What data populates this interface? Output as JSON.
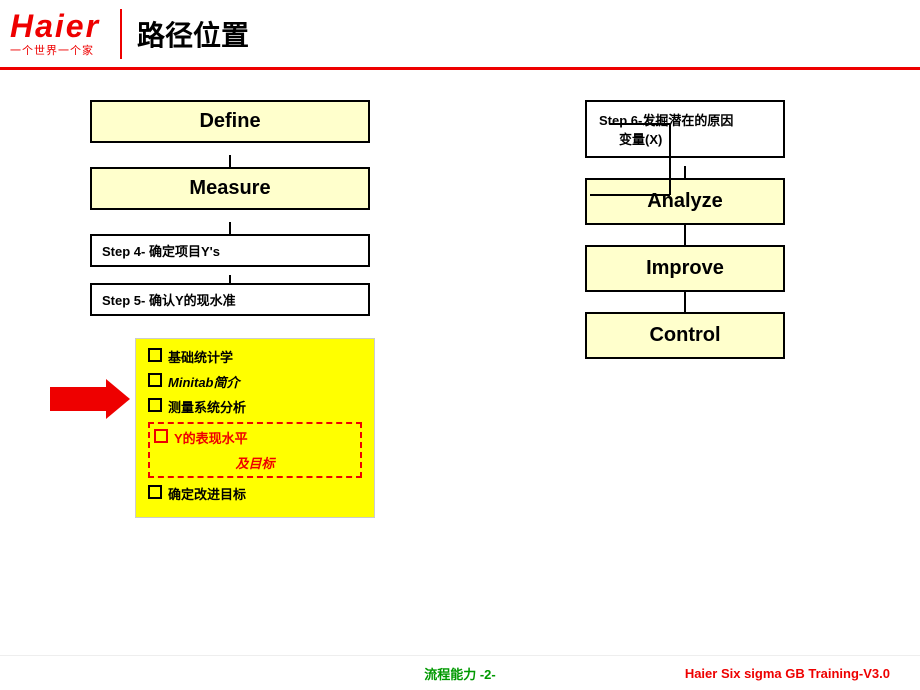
{
  "header": {
    "logo": "Haier",
    "tagline": "一个世界一个家",
    "title": "路径位置"
  },
  "left_column": {
    "define_label": "Define",
    "measure_label": "Measure",
    "step4_label": "Step 4- 确定项目Y's",
    "step5_label": "Step 5- 确认Y的现水准",
    "detail_items": [
      {
        "text": "基础统计学",
        "italic": false,
        "highlight": false
      },
      {
        "text": "Minitab简介",
        "italic": true,
        "highlight": false
      },
      {
        "text": "测量系统分析",
        "italic": false,
        "highlight": false
      },
      {
        "text": "Y的表现水平",
        "italic": false,
        "highlight": true,
        "dashed": true
      },
      {
        "text": "及目标",
        "italic": true,
        "highlight": true,
        "continuation": true
      },
      {
        "text": "确定改进目标",
        "italic": false,
        "highlight": false
      }
    ]
  },
  "right_column": {
    "step6_line1": "Step 6-发掘潜在的原因",
    "step6_line2": "变量(X)",
    "analyze_label": "Analyze",
    "improve_label": "Improve",
    "control_label": "Control"
  },
  "footer": {
    "center_text": "流程能力 -2-",
    "right_text": "Haier Six sigma GB Training-V3.0"
  }
}
